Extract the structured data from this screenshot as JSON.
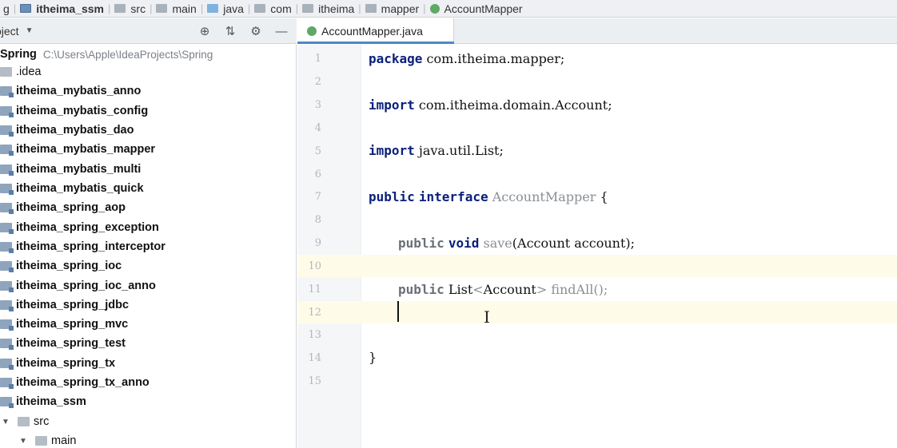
{
  "breadcrumb": [
    {
      "label": "g",
      "icon": "folder-icon"
    },
    {
      "label": "itheima_ssm",
      "icon": "module-icon",
      "bold": true
    },
    {
      "label": "src",
      "icon": "folder-icon"
    },
    {
      "label": "main",
      "icon": "folder-icon"
    },
    {
      "label": "java",
      "icon": "source-folder-icon"
    },
    {
      "label": "com",
      "icon": "package-icon"
    },
    {
      "label": "itheima",
      "icon": "package-icon"
    },
    {
      "label": "mapper",
      "icon": "package-icon"
    },
    {
      "label": "AccountMapper",
      "icon": "interface-icon"
    }
  ],
  "project_panel": {
    "title": "oject",
    "tools": [
      "locate-icon",
      "collapse-icon",
      "gear-icon",
      "minimize-icon"
    ],
    "root": {
      "name": "Spring",
      "path": "C:\\Users\\Apple\\IdeaProjects\\Spring"
    },
    "items": [
      ".idea",
      "itheima_mybatis_anno",
      "itheima_mybatis_config",
      "itheima_mybatis_dao",
      "itheima_mybatis_mapper",
      "itheima_mybatis_multi",
      "itheima_mybatis_quick",
      "itheima_spring_aop",
      "itheima_spring_exception",
      "itheima_spring_interceptor",
      "itheima_spring_ioc",
      "itheima_spring_ioc_anno",
      "itheima_spring_jdbc",
      "itheima_spring_mvc",
      "itheima_spring_test",
      "itheima_spring_tx",
      "itheima_spring_tx_anno",
      "itheima_ssm"
    ],
    "children": [
      "src",
      "main"
    ]
  },
  "editor": {
    "tab_label": "AccountMapper.java",
    "line_numbers": [
      "1",
      "2",
      "3",
      "4",
      "5",
      "6",
      "7",
      "8",
      "9",
      "10",
      "11",
      "12",
      "13",
      "14",
      "15"
    ],
    "code": {
      "l1_kw": "package",
      "l1_rest": " com.itheima.mapper;",
      "l3_kw": "import",
      "l3_rest": " com.itheima.domain.Account;",
      "l5_kw": "import",
      "l5_rest": " java.util.List;",
      "l7_kw1": "public",
      "l7_kw2": "interface",
      "l7_name": "AccountMapper",
      "l7_rest": " {",
      "l9_kw1": "public",
      "l9_kw2": "void",
      "l9_method": "save",
      "l9_rest": "(Account account);",
      "l11_kw1": "public",
      "l11_type": " List",
      "l11_lt": "<",
      "l11_gen": "Account",
      "l11_gt": ">",
      "l11_rest": " findAll();",
      "l14": "}"
    }
  }
}
